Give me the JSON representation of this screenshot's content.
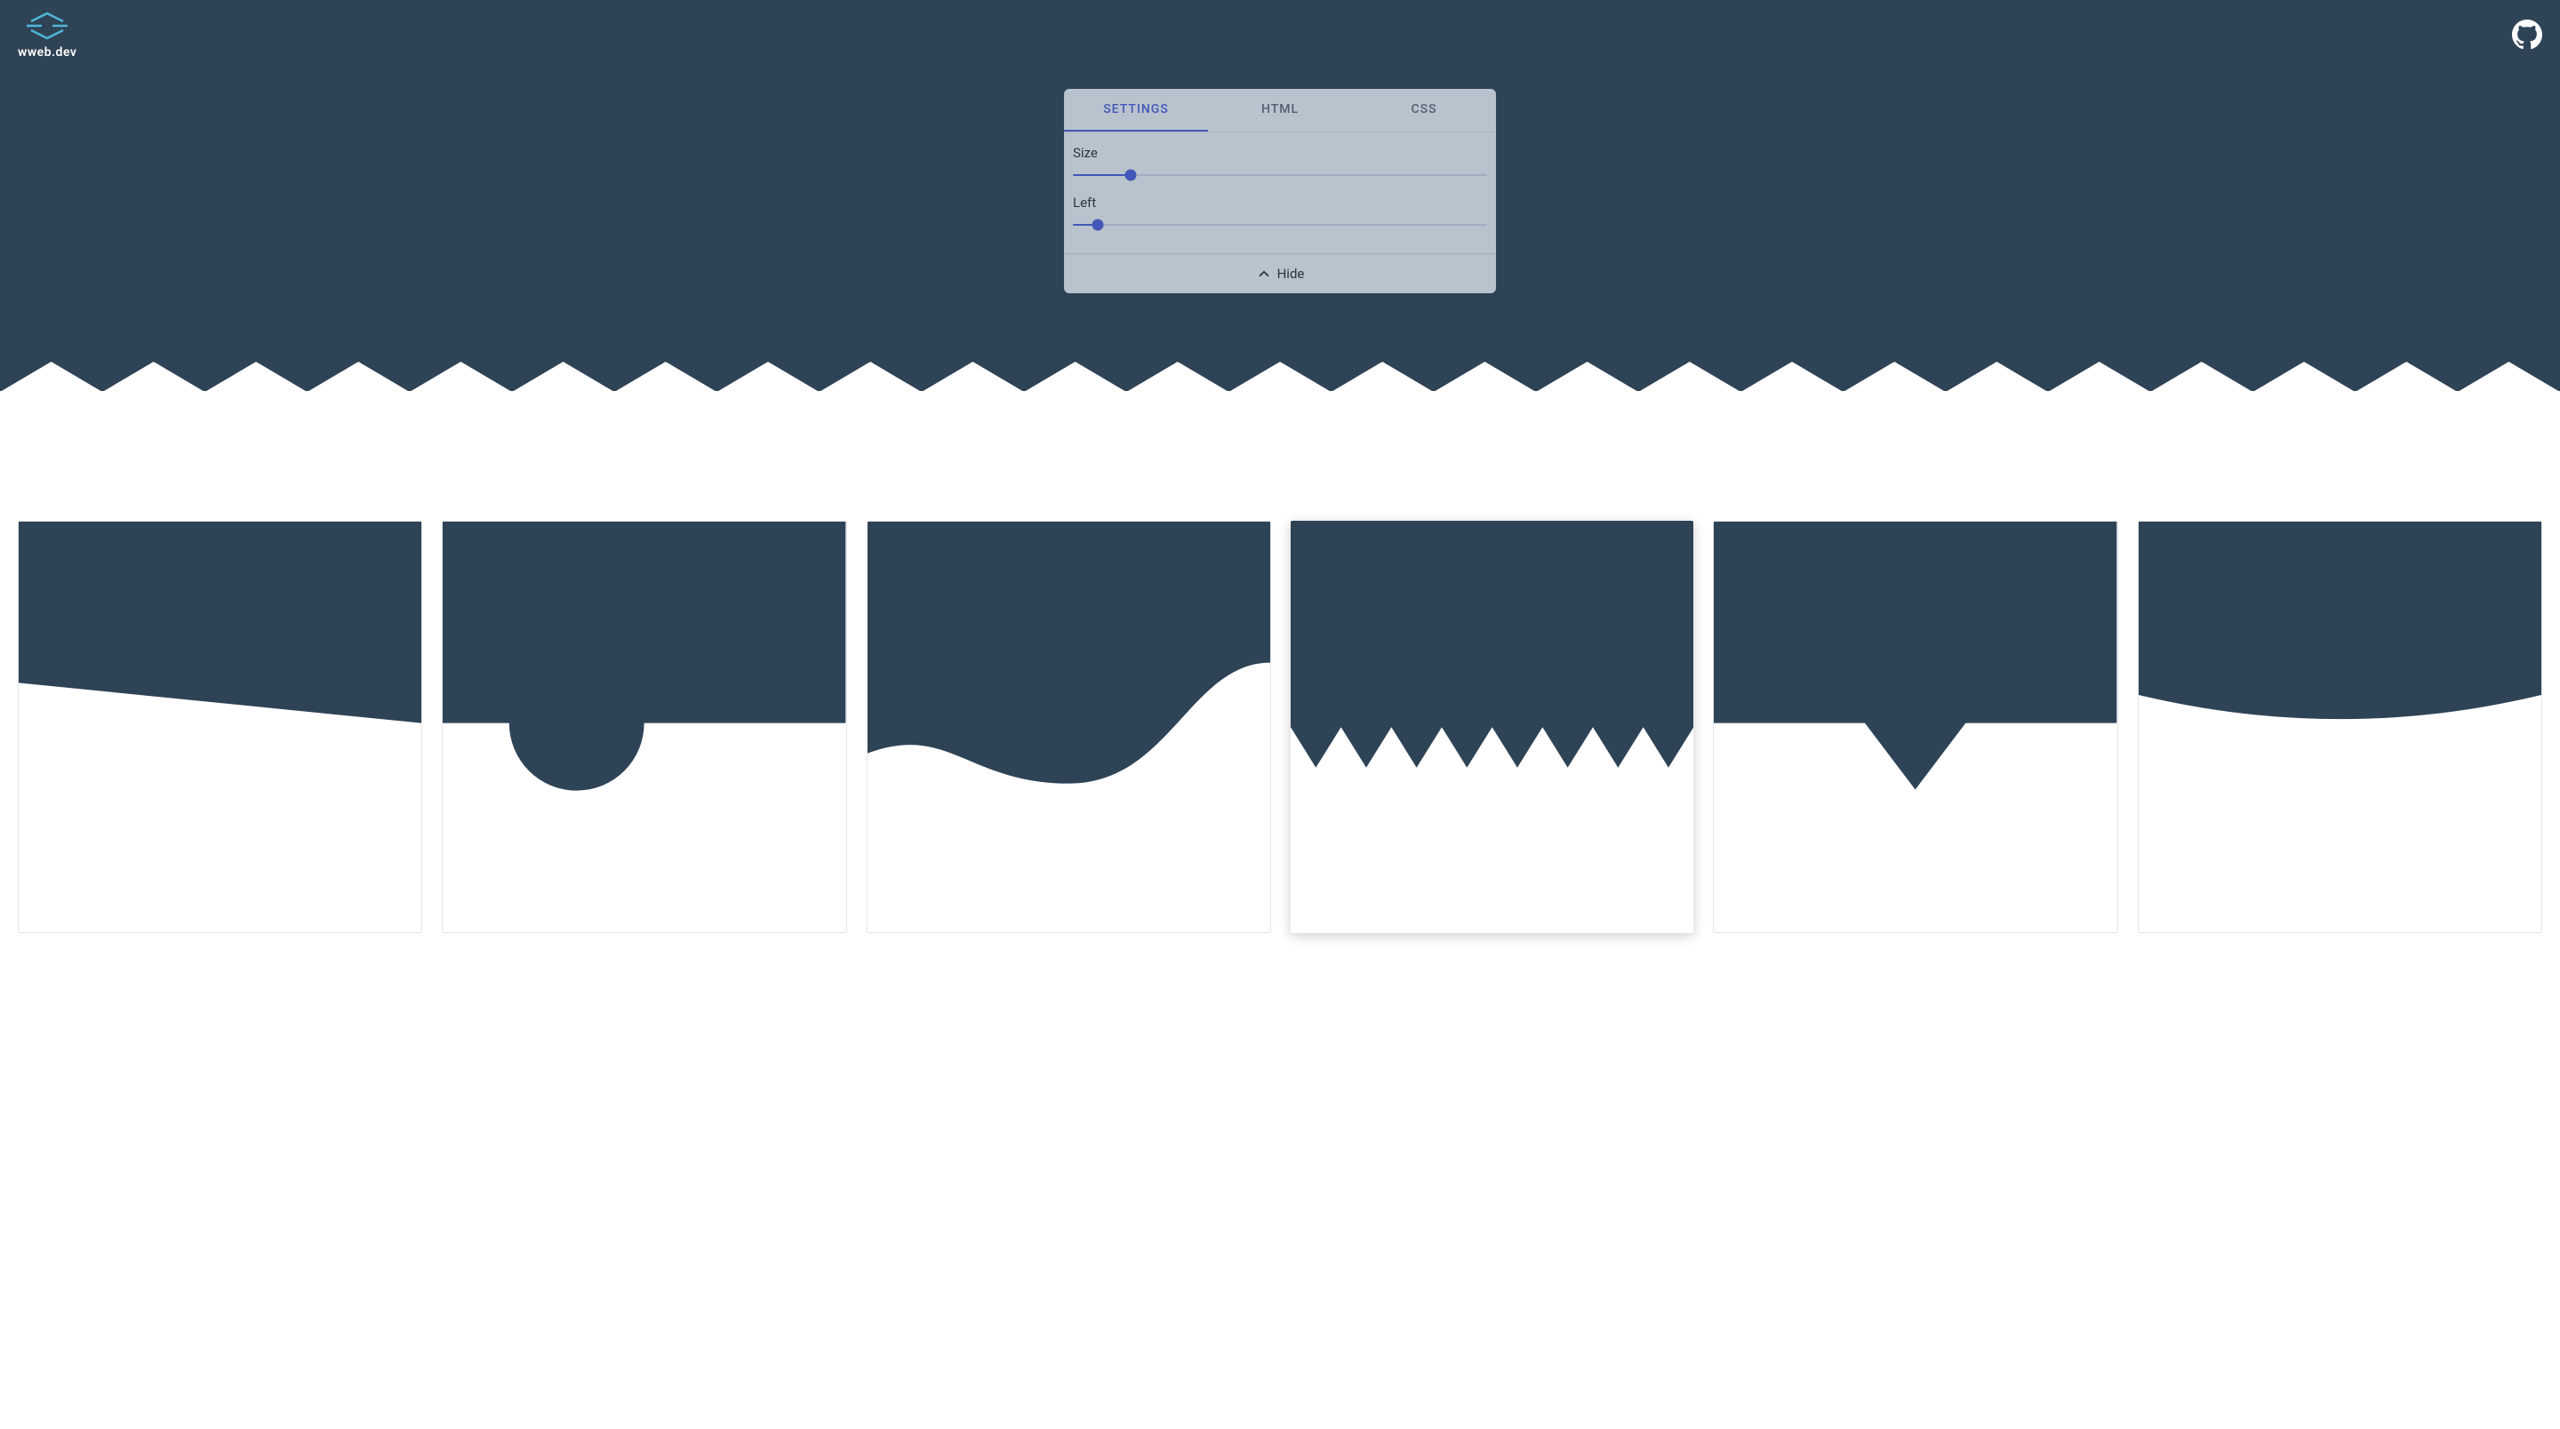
{
  "header": {
    "logo_text": "wweb.dev"
  },
  "panel": {
    "tabs": {
      "settings": "SETTINGS",
      "html": "HTML",
      "css": "CSS"
    },
    "settings": {
      "size_label": "Size",
      "size_value": 14,
      "left_label": "Left",
      "left_value": 6
    },
    "hide_label": "Hide"
  },
  "colors": {
    "primary_bg": "#2f4356",
    "accent": "#4457b8",
    "panel_bg": "rgba(205,213,222,0.88)"
  },
  "cards": [
    {
      "type": "diagonal",
      "active": false
    },
    {
      "type": "semicircle",
      "active": false
    },
    {
      "type": "wave",
      "active": false
    },
    {
      "type": "zigzag",
      "active": true
    },
    {
      "type": "triangle",
      "active": false
    },
    {
      "type": "curve",
      "active": false
    }
  ]
}
